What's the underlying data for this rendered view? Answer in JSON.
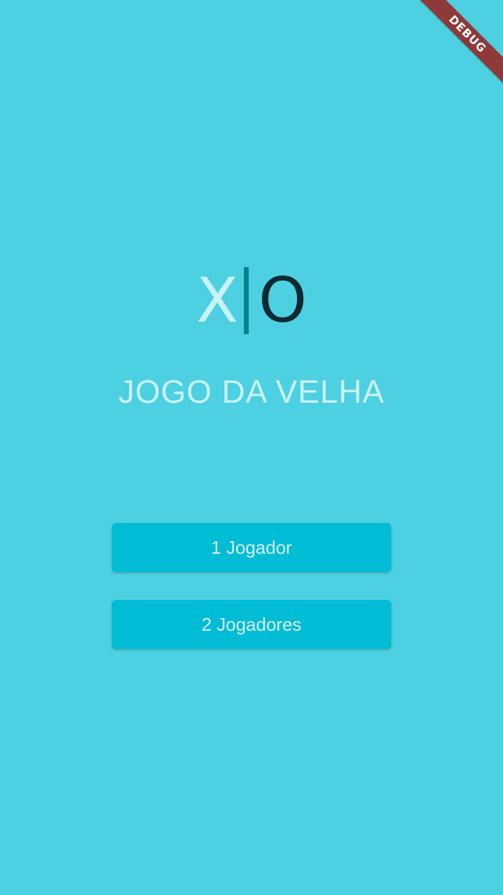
{
  "debug_banner": {
    "label": "DEBUG"
  },
  "logo": {
    "left_symbol": "X",
    "right_symbol": "O"
  },
  "title": "JOGO DA VELHA",
  "buttons": {
    "one_player": "1 Jogador",
    "two_players": "2 Jogadores"
  },
  "colors": {
    "background": "#4DD0E1",
    "button": "#00BCD4",
    "divider": "#00838F",
    "x_symbol": "#C7F2F7",
    "o_symbol": "#0D2A33",
    "debug_ribbon": "#8E3A3A"
  }
}
